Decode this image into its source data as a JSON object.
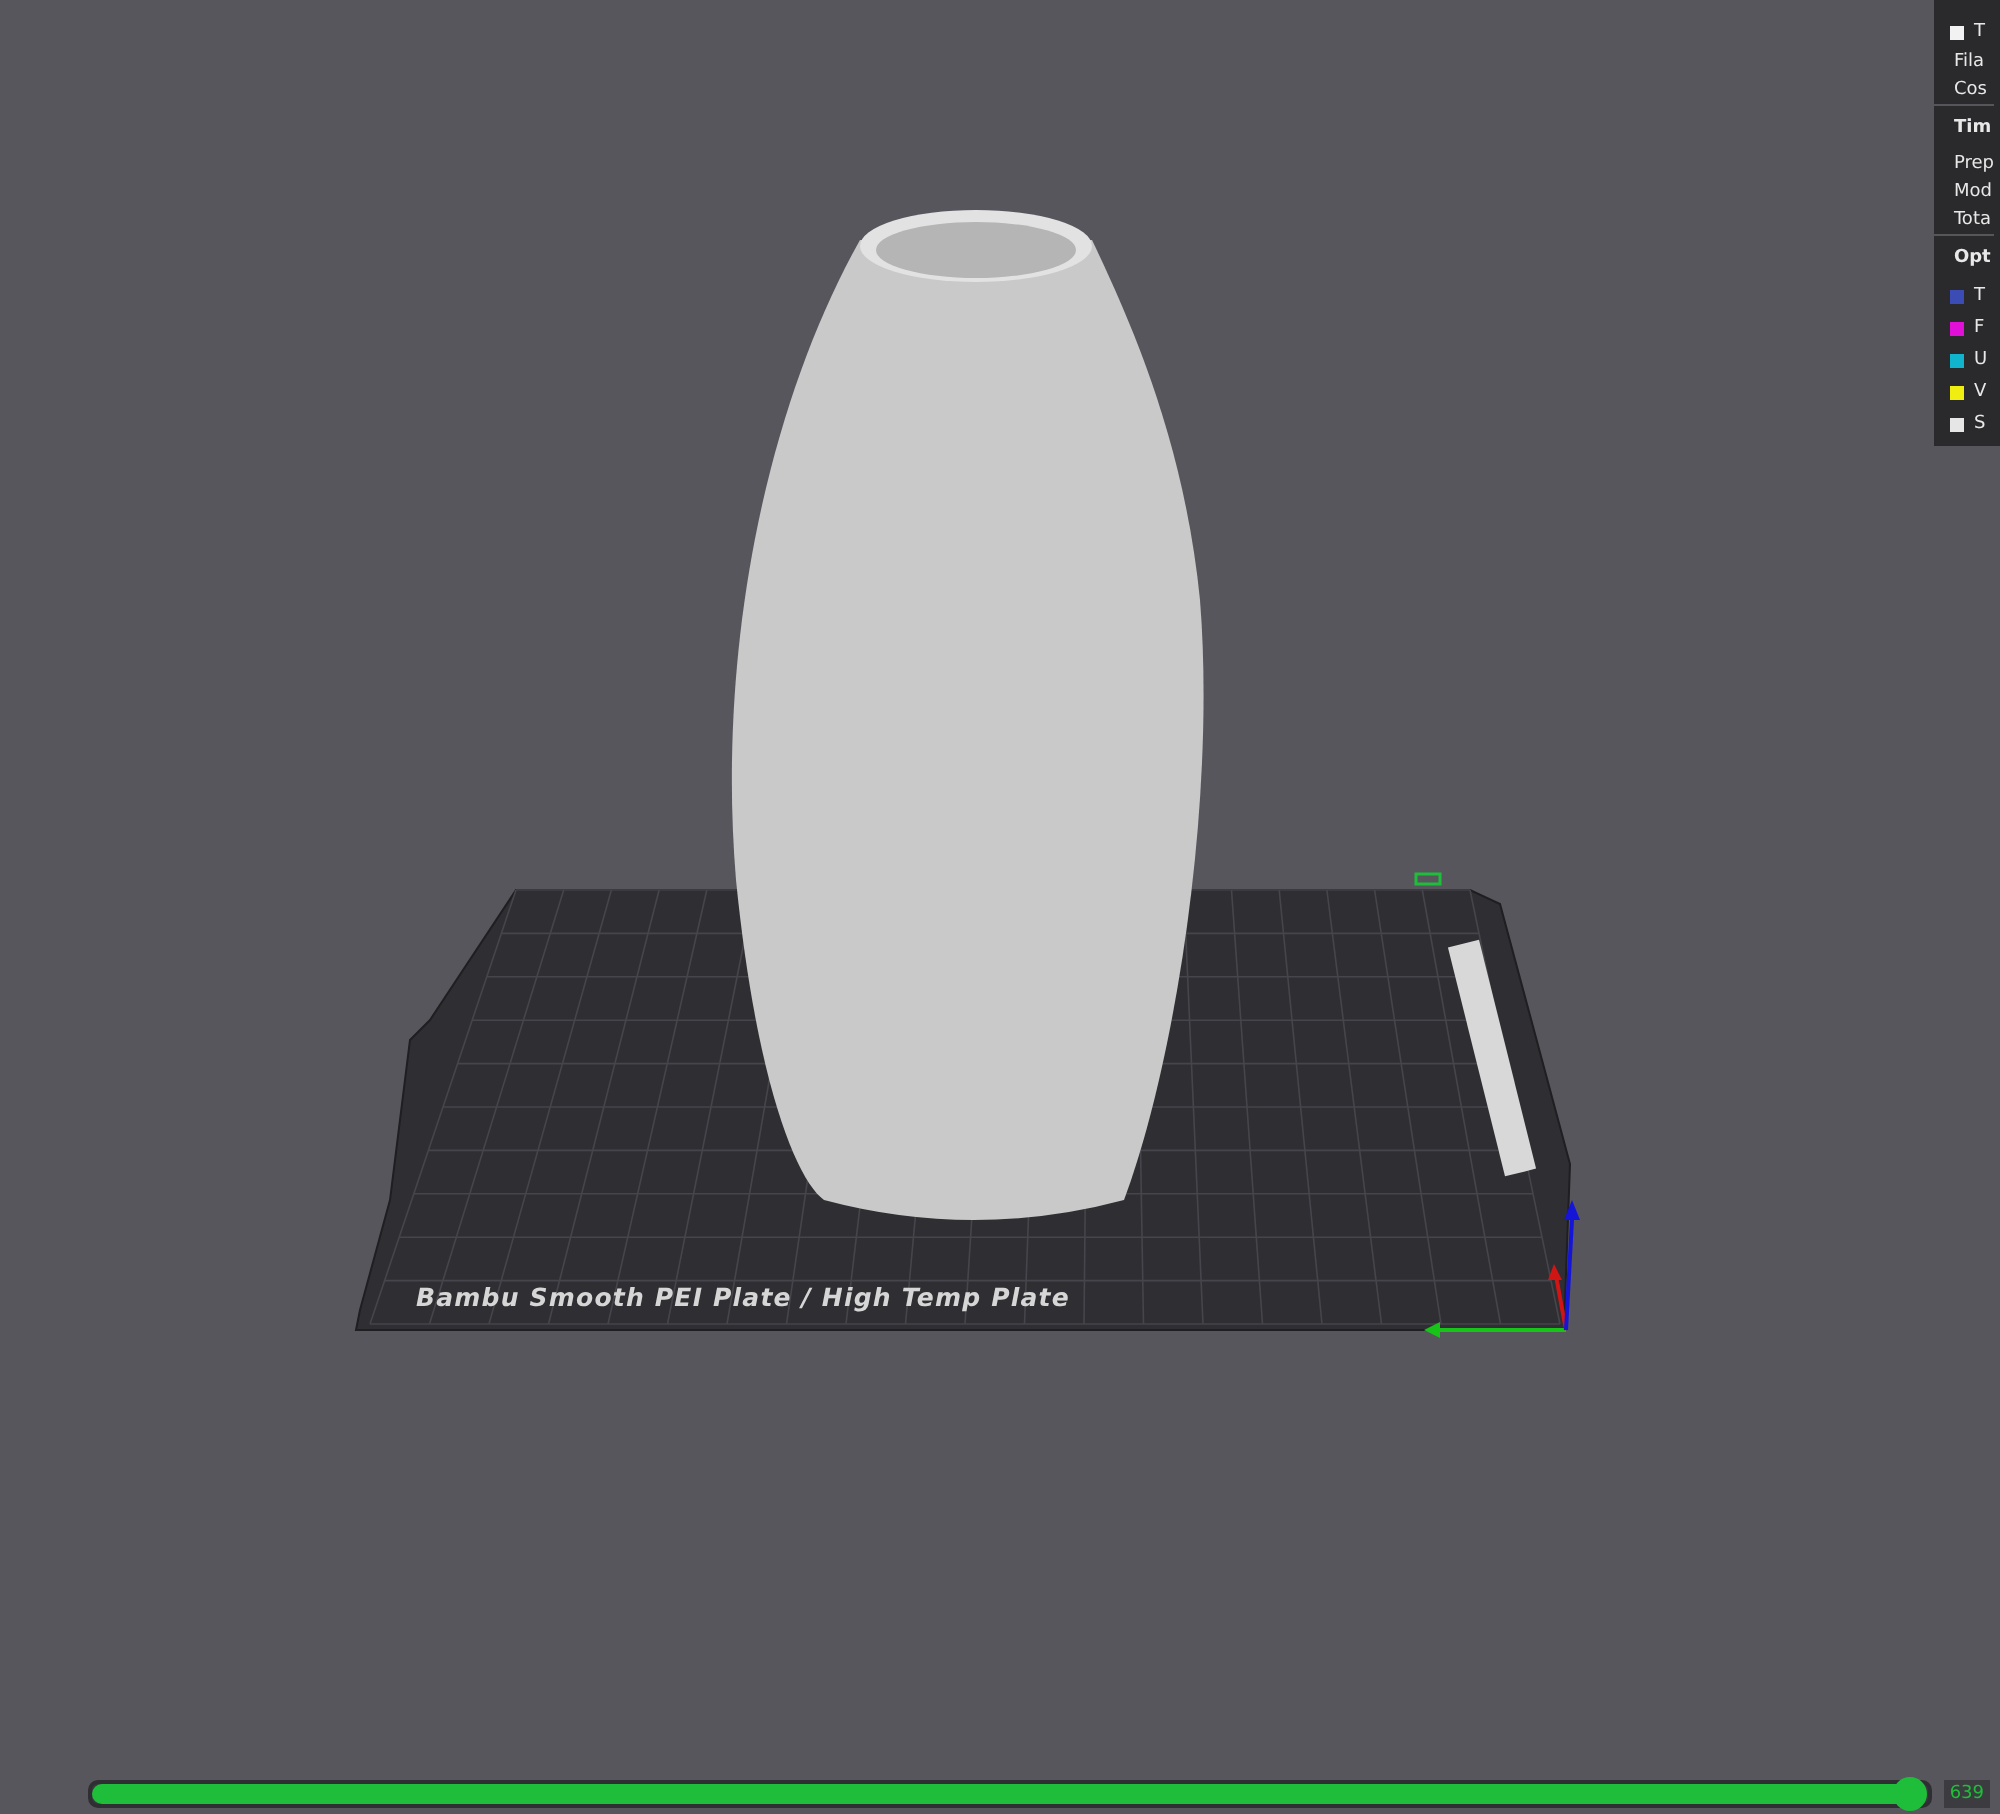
{
  "viewport": {
    "plate_label": "Bambu Smooth PEI Plate / High Temp Plate"
  },
  "stats_panel": {
    "rows": [
      {
        "kind": "legend",
        "label": "T",
        "color": "#f2f2f2"
      },
      {
        "kind": "text",
        "label": "Fila"
      },
      {
        "kind": "text",
        "label": "Cos"
      },
      {
        "kind": "header",
        "label": "Tim"
      },
      {
        "kind": "text",
        "label": "Prep"
      },
      {
        "kind": "text",
        "label": "Mod"
      },
      {
        "kind": "text",
        "label": "Tota"
      },
      {
        "kind": "header",
        "label": "Opt"
      },
      {
        "kind": "legend",
        "label": "T",
        "color": "#3b4cb4"
      },
      {
        "kind": "legend",
        "label": "F",
        "color": "#e010d8"
      },
      {
        "kind": "legend",
        "label": "U",
        "color": "#10b4cc"
      },
      {
        "kind": "legend",
        "label": "V",
        "color": "#f0ee10"
      },
      {
        "kind": "legend",
        "label": "S",
        "color": "#e6e6e6"
      }
    ]
  },
  "layer_slider": {
    "level": 0.99,
    "reading": "639"
  }
}
